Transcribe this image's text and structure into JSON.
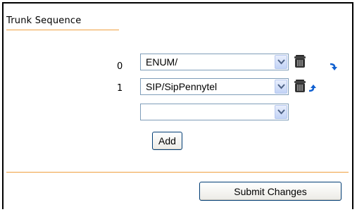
{
  "panel": {
    "title": "Trunk Sequence"
  },
  "trunks": [
    {
      "index": "0",
      "value": "ENUM/",
      "move_icon": "move-down-icon"
    },
    {
      "index": "1",
      "value": "SIP/SipPennytel",
      "move_icon": "move-up-icon"
    }
  ],
  "new_trunk": {
    "value": ""
  },
  "buttons": {
    "add_label": "Add",
    "submit_label": "Submit Changes"
  },
  "colors": {
    "accent_line": "#f0a040",
    "select_border": "#7f9db9",
    "arrow_blue": "#1060d0"
  }
}
